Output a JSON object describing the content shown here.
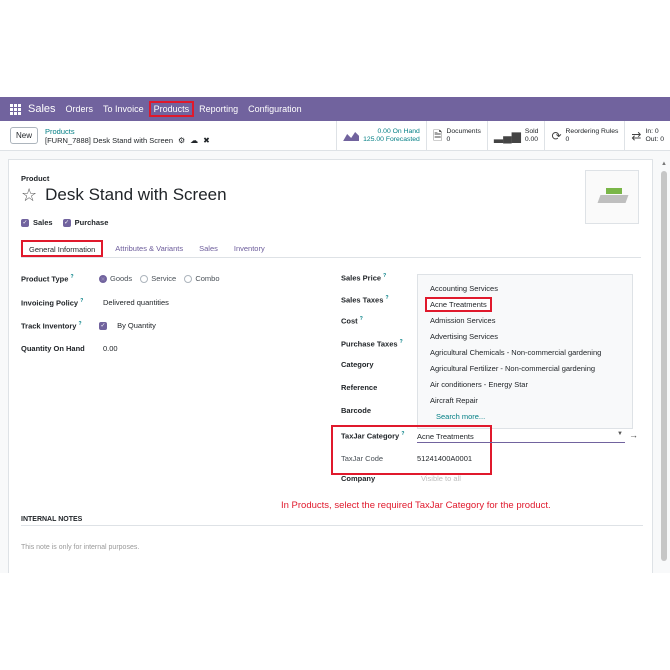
{
  "nav": {
    "brand": "Sales",
    "menus": [
      "Orders",
      "To Invoice",
      "Products",
      "Reporting",
      "Configuration"
    ]
  },
  "control": {
    "new_label": "New",
    "breadcrumb": "Products",
    "record": "[FURN_7888] Desk Stand with Screen",
    "stats": {
      "on_hand": "0.00 On Hand",
      "forecasted": "125.00 Forecasted",
      "documents_label": "Documents",
      "documents_count": "0",
      "sold_label": "Sold",
      "sold_value": "0.00",
      "reorder_label": "Reordering Rules",
      "reorder_count": "0",
      "in_label": "In: 0",
      "out_label": "Out: 0"
    }
  },
  "form": {
    "section_label": "Product",
    "name": "Desk Stand with Screen",
    "sales_label": "Sales",
    "purchase_label": "Purchase",
    "tabs": [
      "General Information",
      "Attributes & Variants",
      "Sales",
      "Inventory"
    ],
    "left": {
      "product_type_label": "Product Type",
      "type_options": [
        "Goods",
        "Service",
        "Combo"
      ],
      "invoicing_label": "Invoicing Policy",
      "invoicing_value": "Delivered quantities",
      "track_label": "Track Inventory",
      "track_value": "By Quantity",
      "qoh_label": "Quantity On Hand",
      "qoh_value": "0.00"
    },
    "right": {
      "sales_price_label": "Sales Price",
      "sales_taxes_label": "Sales Taxes",
      "cost_label": "Cost",
      "purchase_taxes_label": "Purchase Taxes",
      "category_label": "Category",
      "reference_label": "Reference",
      "barcode_label": "Barcode",
      "taxjar_category_label": "TaxJar Category",
      "taxjar_category_value": "Acne Treatments",
      "taxjar_code_label": "TaxJar Code",
      "taxjar_code_value": "51241400A0001",
      "company_label": "Company",
      "company_placeholder": "Visible to all"
    },
    "dropdown": {
      "items": [
        "Accounting Services",
        "Acne Treatments",
        "Admission Services",
        "Advertising Services",
        "Agricultural Chemicals - Non-commercial gardening",
        "Agricultural Fertilizer - Non-commercial gardening",
        "Air conditioners - Energy Star",
        "Aircraft Repair"
      ],
      "search_more": "Search more..."
    },
    "annotation": "In Products, select the required TaxJar Category for the product.",
    "internal_notes_label": "INTERNAL NOTES",
    "internal_notes_placeholder": "This note is only for internal purposes."
  },
  "colors": {
    "brand": "#71639e",
    "link": "#017e84",
    "highlight": "#e0192c"
  }
}
